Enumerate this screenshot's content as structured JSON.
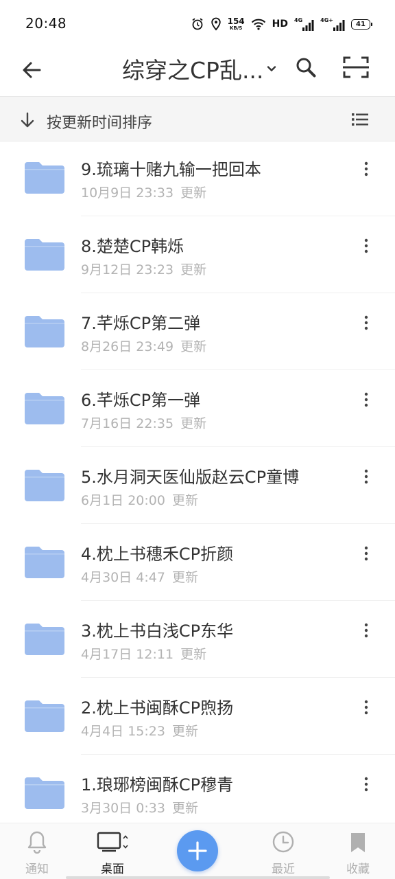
{
  "status_bar": {
    "time": "20:48",
    "net_speed": "154",
    "net_speed_unit": "KB/S",
    "hd": "HD",
    "sim1_type": "4G",
    "sim2_type": "4G+",
    "battery": "41"
  },
  "header": {
    "title": "综穿之CP乱...",
    "icons": [
      "back-arrow-icon",
      "chevron-down-icon",
      "search-icon",
      "scan-icon"
    ]
  },
  "sort_bar": {
    "label": "按更新时间排序",
    "icons": [
      "arrow-down-icon",
      "list-view-icon"
    ]
  },
  "colors": {
    "accent": "#5b9af0",
    "folder": "#9dbcee",
    "meta_text": "#b3b3b3",
    "title_text": "#333333"
  },
  "files": [
    {
      "name": "9.琉璃十赌九输一把回本",
      "date": "10月9日 23:33",
      "status": "更新"
    },
    {
      "name": "8.楚楚CP韩烁",
      "date": "9月12日 23:23",
      "status": "更新"
    },
    {
      "name": "7.芊烁CP第二弹",
      "date": "8月26日 23:49",
      "status": "更新"
    },
    {
      "name": "6.芊烁CP第一弹",
      "date": "7月16日 22:35",
      "status": "更新"
    },
    {
      "name": "5.水月洞天医仙版赵云CP童博",
      "date": "6月1日 20:00",
      "status": "更新"
    },
    {
      "name": "4.枕上书穗禾CP折颜",
      "date": "4月30日 4:47",
      "status": "更新"
    },
    {
      "name": "3.枕上书白浅CP东华",
      "date": "4月17日 12:11",
      "status": "更新"
    },
    {
      "name": "2.枕上书闽酥CP煦扬",
      "date": "4月4日 15:23",
      "status": "更新"
    },
    {
      "name": "1.琅琊榜闽酥CP穆青",
      "date": "3月30日 0:33",
      "status": "更新"
    }
  ],
  "bottom_nav": {
    "items": [
      {
        "label": "通知",
        "icon": "bell-icon"
      },
      {
        "label": "桌面",
        "icon": "desktop-icon",
        "active": true
      },
      {
        "label": "最近",
        "icon": "clock-icon"
      },
      {
        "label": "收藏",
        "icon": "bookmark-icon"
      }
    ],
    "fab_icon": "plus-icon"
  }
}
